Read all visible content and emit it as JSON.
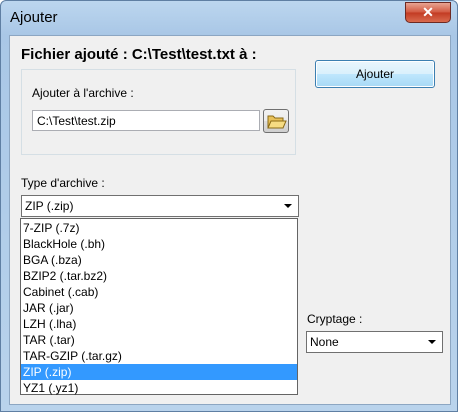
{
  "window": {
    "title": "Ajouter",
    "close_label": "✕"
  },
  "heading": "Fichier ajouté : C:\\Test\\test.txt à :",
  "archive_group": {
    "label": "Ajouter à l'archive :",
    "path_value": "C:\\Test\\test.zip"
  },
  "add_button_label": "Ajouter",
  "archive_type": {
    "label": "Type d'archive :",
    "selected": "ZIP (.zip)",
    "options": [
      "7-ZIP (.7z)",
      "BlackHole (.bh)",
      "BGA (.bza)",
      "BZIP2 (.tar.bz2)",
      "Cabinet (.cab)",
      "JAR (.jar)",
      "LZH (.lha)",
      "TAR (.tar)",
      "TAR-GZIP (.tar.gz)",
      "ZIP (.zip)",
      "YZ1 (.yz1)"
    ],
    "highlighted_index": 9
  },
  "encryption": {
    "label": "Cryptage :",
    "selected": "None"
  },
  "icons": {
    "folder": "open-folder-icon",
    "close": "close-icon",
    "dropdown": "chevron-down-icon"
  },
  "colors": {
    "selection": "#3399ff",
    "close_button": "#c23a22"
  }
}
